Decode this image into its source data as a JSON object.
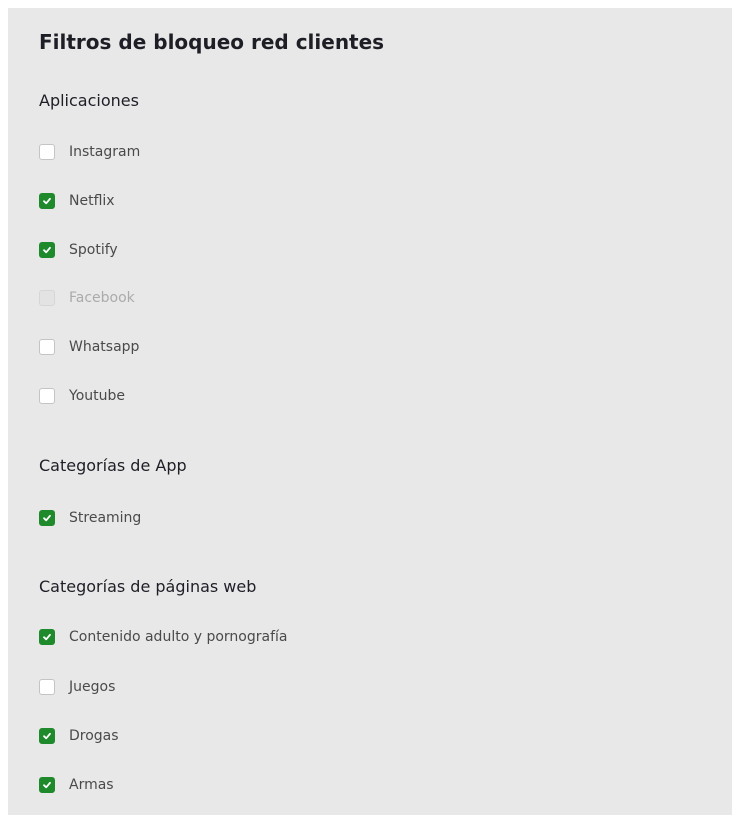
{
  "panel": {
    "title": "Filtros de bloqueo red clientes"
  },
  "colors": {
    "panel_background": "#e8e8e8",
    "checked_green": "#1f8a2b",
    "checkbox_border": "#c4c4c4",
    "disabled_text": "#ababab"
  },
  "sections": [
    {
      "title": "Aplicaciones",
      "items": [
        {
          "label": "Instagram",
          "checked": false,
          "disabled": false
        },
        {
          "label": "Netflix",
          "checked": true,
          "disabled": false
        },
        {
          "label": "Spotify",
          "checked": true,
          "disabled": false
        },
        {
          "label": "Facebook",
          "checked": false,
          "disabled": true
        },
        {
          "label": "Whatsapp",
          "checked": false,
          "disabled": false
        },
        {
          "label": "Youtube",
          "checked": false,
          "disabled": false
        }
      ]
    },
    {
      "title": "Categorías de App",
      "items": [
        {
          "label": "Streaming",
          "checked": true,
          "disabled": false
        }
      ]
    },
    {
      "title": "Categorías de páginas web",
      "items": [
        {
          "label": "Contenido adulto y pornografía",
          "checked": true,
          "disabled": false
        },
        {
          "label": "Juegos",
          "checked": false,
          "disabled": false
        },
        {
          "label": "Drogas",
          "checked": true,
          "disabled": false
        },
        {
          "label": "Armas",
          "checked": true,
          "disabled": false
        }
      ]
    }
  ]
}
